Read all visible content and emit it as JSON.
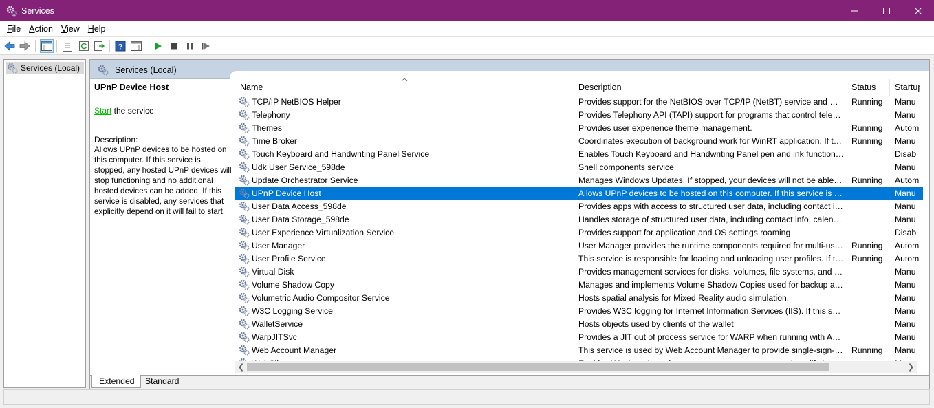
{
  "window": {
    "title": "Services"
  },
  "menu": [
    {
      "pre": "",
      "u": "F",
      "post": "ile"
    },
    {
      "pre": "",
      "u": "A",
      "post": "ction"
    },
    {
      "pre": "",
      "u": "V",
      "post": "iew"
    },
    {
      "pre": "",
      "u": "H",
      "post": "elp"
    }
  ],
  "tree": {
    "root_label": "Services (Local)"
  },
  "content": {
    "header_title": "Services (Local)",
    "detail": {
      "service_name": "UPnP Device Host",
      "action_link": "Start",
      "action_rest": " the service",
      "description_label": "Description:",
      "description_text": "Allows UPnP devices to be hosted on this computer. If this service is stopped, any hosted UPnP devices will stop functioning and no additional hosted devices can be added. If this service is disabled, any services that explicitly depend on it will fail to start."
    },
    "columns": {
      "name": "Name",
      "description": "Description",
      "status": "Status",
      "startup": "Startup"
    },
    "services": [
      {
        "name": "TCP/IP NetBIOS Helper",
        "description": "Provides support for the NetBIOS over TCP/IP (NetBT) service and NetBI...",
        "status": "Running",
        "startup": "Manu"
      },
      {
        "name": "Telephony",
        "description": "Provides Telephony API (TAPI) support for programs that control teleph...",
        "status": "",
        "startup": "Manu"
      },
      {
        "name": "Themes",
        "description": "Provides user experience theme management.",
        "status": "Running",
        "startup": "Autom"
      },
      {
        "name": "Time Broker",
        "description": "Coordinates execution of background work for WinRT application. If thi...",
        "status": "Running",
        "startup": "Manu"
      },
      {
        "name": "Touch Keyboard and Handwriting Panel Service",
        "description": "Enables Touch Keyboard and Handwriting Panel pen and ink functional...",
        "status": "",
        "startup": "Disab"
      },
      {
        "name": "Udk User Service_598de",
        "description": "Shell components service",
        "status": "",
        "startup": "Manu"
      },
      {
        "name": "Update Orchestrator Service",
        "description": "Manages Windows Updates. If stopped, your devices will not be able to...",
        "status": "Running",
        "startup": "Autom"
      },
      {
        "name": "UPnP Device Host",
        "description": "Allows UPnP devices to be hosted on this computer. If this service is sto...",
        "status": "",
        "startup": "Manu",
        "selected": true
      },
      {
        "name": "User Data Access_598de",
        "description": "Provides apps with access to structured user data, including contact inf...",
        "status": "",
        "startup": "Manu"
      },
      {
        "name": "User Data Storage_598de",
        "description": "Handles storage of structured user data, including contact info, calend...",
        "status": "",
        "startup": "Manu"
      },
      {
        "name": "User Experience Virtualization Service",
        "description": "Provides support for application and OS settings roaming",
        "status": "",
        "startup": "Disab"
      },
      {
        "name": "User Manager",
        "description": "User Manager provides the runtime components required for multi-use...",
        "status": "Running",
        "startup": "Autom"
      },
      {
        "name": "User Profile Service",
        "description": "This service is responsible for loading and unloading user profiles. If thi...",
        "status": "Running",
        "startup": "Autom"
      },
      {
        "name": "Virtual Disk",
        "description": "Provides management services for disks, volumes, file systems, and sto...",
        "status": "",
        "startup": "Manu"
      },
      {
        "name": "Volume Shadow Copy",
        "description": "Manages and implements Volume Shadow Copies used for backup and...",
        "status": "",
        "startup": "Manu"
      },
      {
        "name": "Volumetric Audio Compositor Service",
        "description": "Hosts spatial analysis for Mixed Reality audio simulation.",
        "status": "",
        "startup": "Manu"
      },
      {
        "name": "W3C Logging Service",
        "description": "Provides W3C logging for Internet Information Services (IIS). If this servi...",
        "status": "",
        "startup": "Manu"
      },
      {
        "name": "WalletService",
        "description": "Hosts objects used by clients of the wallet",
        "status": "",
        "startup": "Manu"
      },
      {
        "name": "WarpJITSvc",
        "description": "Provides a JIT out of process service for WARP when running with ACG ...",
        "status": "",
        "startup": "Manu"
      },
      {
        "name": "Web Account Manager",
        "description": "This service is used by Web Account Manager to provide single-sign-o...",
        "status": "Running",
        "startup": "Manu"
      },
      {
        "name": "WebClient",
        "description": "Enables Windows-based programs to create, access, and modify Intern...",
        "status": "",
        "startup": "Manu"
      }
    ],
    "tabs": {
      "extended": "Extended",
      "standard": "Standard"
    }
  },
  "colors": {
    "titlebar": "#832277",
    "selection": "#0078d7",
    "pane_header": "#c5d3e3",
    "start_link": "#00c000"
  }
}
